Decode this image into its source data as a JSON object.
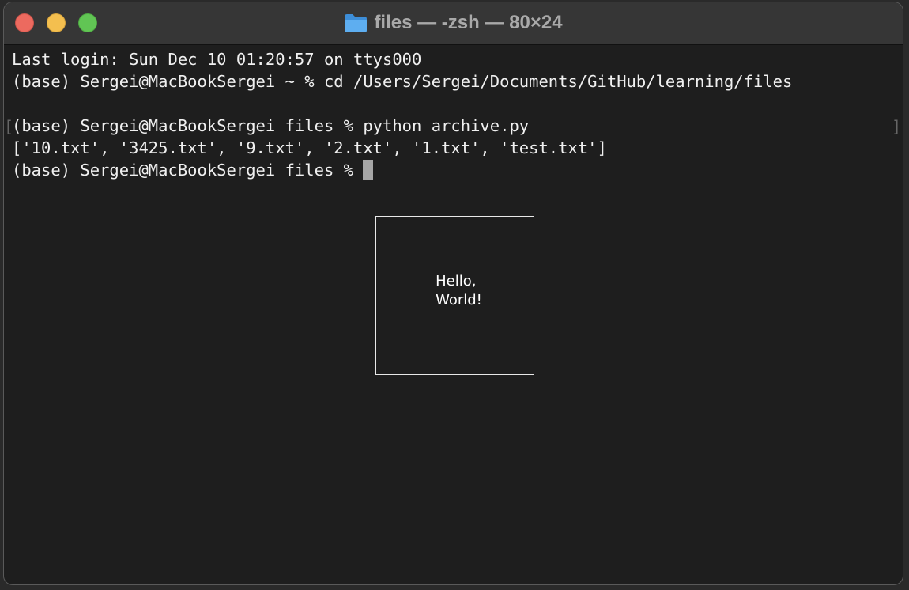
{
  "window": {
    "title": "files — -zsh — 80×24"
  },
  "terminal": {
    "lines": [
      "Last login: Sun Dec 10 01:20:57 on ttys000",
      "(base) Sergei@MacBookSergei ~ % cd /Users/Sergei/Documents/GitHub/learning/files",
      "",
      "(base) Sergei@MacBookSergei files % python archive.py",
      "['10.txt', '3425.txt', '9.txt', '2.txt', '1.txt', 'test.txt']"
    ],
    "prompt": "(base) Sergei@MacBookSergei files % ",
    "mark_left": "[",
    "mark_right": "]"
  },
  "popup": {
    "line1": "Hello,",
    "line2": "World!"
  },
  "icons": {
    "title_icon": "folder-icon"
  },
  "colors": {
    "close": "#ec6a5f",
    "minimize": "#f4bf4f",
    "zoom": "#61c554",
    "background": "#1e1e1e",
    "text": "#f0f0f0",
    "cursor": "#a6a6a6"
  }
}
